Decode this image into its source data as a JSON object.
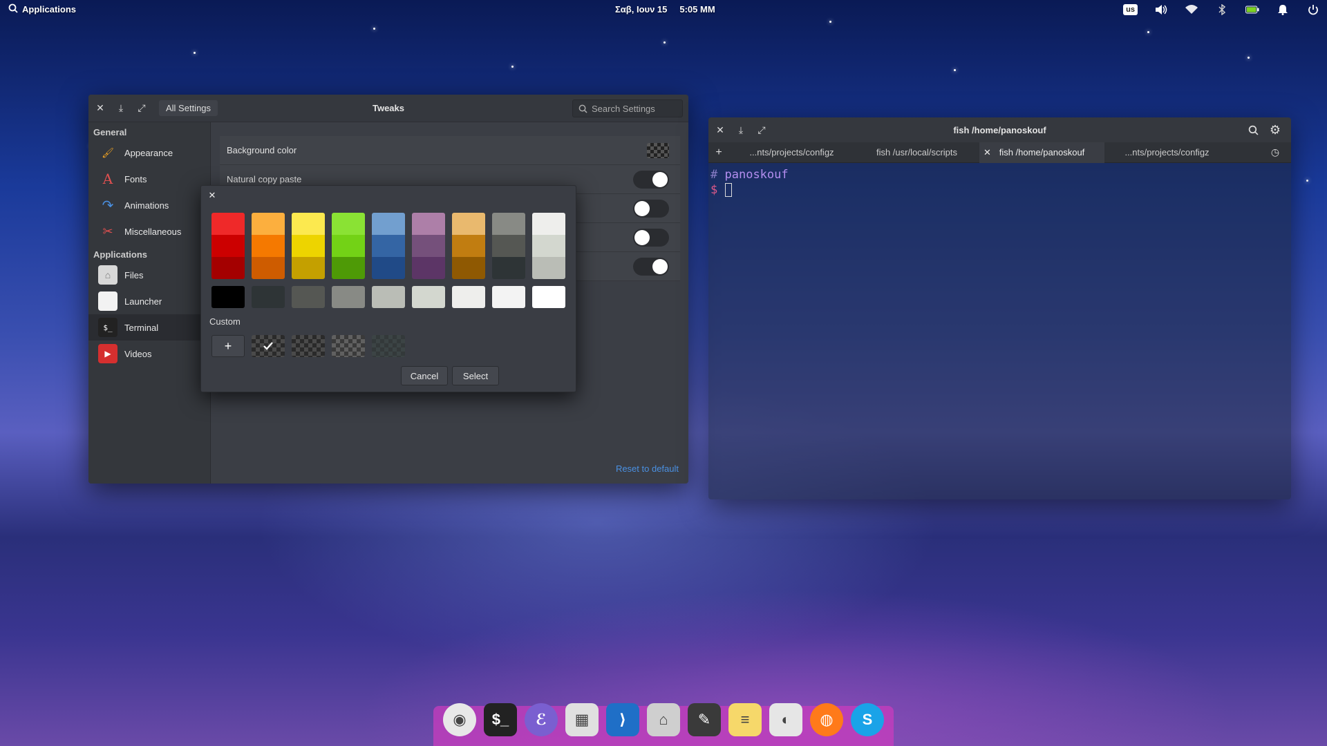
{
  "panel": {
    "apps_label": "Applications",
    "date": "Σαβ, Ιουν 15",
    "time": "5:05 ΜΜ",
    "keyboard": "us"
  },
  "tweaks": {
    "breadcrumb": "All Settings",
    "title": "Tweaks",
    "search_placeholder": "Search Settings",
    "sidebar": {
      "general_heading": "General",
      "general_items": [
        {
          "label": "Appearance",
          "icon": "appearance-icon"
        },
        {
          "label": "Fonts",
          "icon": "fonts-icon"
        },
        {
          "label": "Animations",
          "icon": "animations-icon"
        },
        {
          "label": "Miscellaneous",
          "icon": "miscellaneous-icon"
        }
      ],
      "apps_heading": "Applications",
      "app_items": [
        {
          "label": "Files",
          "icon": "files-icon"
        },
        {
          "label": "Launcher",
          "icon": "launcher-icon"
        },
        {
          "label": "Terminal",
          "icon": "terminal-icon"
        },
        {
          "label": "Videos",
          "icon": "videos-icon"
        }
      ],
      "active": "Terminal"
    },
    "settings": {
      "background_color_label": "Background color",
      "natural_copy_paste_label": "Natural copy paste",
      "toggles": [
        true,
        false,
        false,
        true
      ]
    },
    "reset_label": "Reset to default"
  },
  "color_dialog": {
    "palette": [
      [
        "#ef2929",
        "#cc0000",
        "#a40000"
      ],
      [
        "#fcaf3e",
        "#f57900",
        "#ce5c00"
      ],
      [
        "#fce94f",
        "#edd400",
        "#c4a000"
      ],
      [
        "#8ae234",
        "#73d216",
        "#4e9a06"
      ],
      [
        "#729fcf",
        "#3465a4",
        "#204a87"
      ],
      [
        "#ad7fa8",
        "#75507b",
        "#5c3566"
      ],
      [
        "#e9b96e",
        "#c17d11",
        "#8f5902"
      ],
      [
        "#888a85",
        "#555753",
        "#2e3436"
      ],
      [
        "#eeeeec",
        "#d3d7cf",
        "#babdb6"
      ]
    ],
    "grays": [
      "#000000",
      "#2e3436",
      "#555753",
      "#888a85",
      "#babdb6",
      "#d3d7cf",
      "#eeeeec",
      "#f3f3f3",
      "#ffffff"
    ],
    "custom_label": "Custom",
    "add_label": "+",
    "cancel_label": "Cancel",
    "select_label": "Select"
  },
  "terminal": {
    "title": "fish  /home/panoskouf",
    "tabs": [
      {
        "label": "...nts/projects/configz",
        "active": false
      },
      {
        "label": "fish  /usr/local/scripts",
        "active": false
      },
      {
        "label": "fish  /home/panoskouf",
        "active": true
      },
      {
        "label": "...nts/projects/configz",
        "active": false
      }
    ],
    "prompt_hash": "#",
    "prompt_user": "panoskouf",
    "prompt_dollar": "$"
  },
  "dock": {
    "apps": [
      {
        "name": "chrome-icon",
        "color": "#e8e8e8"
      },
      {
        "name": "terminal-icon",
        "color": "#222222"
      },
      {
        "name": "emacs-icon",
        "color": "#7a5fd0"
      },
      {
        "name": "appcenter-icon",
        "color": "#e0e0e0"
      },
      {
        "name": "vscode-icon",
        "color": "#1f6fc7"
      },
      {
        "name": "files-icon",
        "color": "#cfcfcf"
      },
      {
        "name": "brush-icon",
        "color": "#3a3a3a"
      },
      {
        "name": "notes-icon",
        "color": "#f6d86a"
      },
      {
        "name": "toggle-settings-icon",
        "color": "#e6e6e6"
      },
      {
        "name": "firefox-icon",
        "color": "#ff7a1a"
      },
      {
        "name": "skype-icon",
        "color": "#1aa3e8"
      }
    ]
  }
}
